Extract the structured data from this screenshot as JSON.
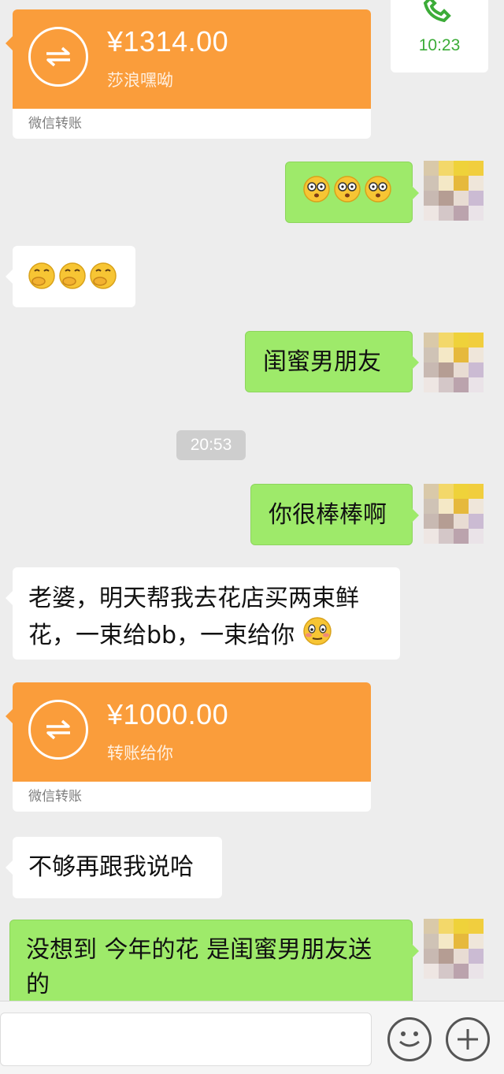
{
  "call": {
    "time": "10:23"
  },
  "transfers": [
    {
      "amount": "¥1314.00",
      "note": "莎浪嘿呦",
      "footer": "微信转账"
    },
    {
      "amount": "¥1000.00",
      "note": "转账给你",
      "footer": "微信转账"
    }
  ],
  "messages": [
    {
      "side": "out",
      "kind": "emoji",
      "emoji": "shocked-face-emoji x3"
    },
    {
      "side": "in",
      "kind": "emoji",
      "emoji": "hand-over-mouth-emoji x3"
    },
    {
      "side": "out",
      "text": "闺蜜男朋友"
    },
    {
      "side": "out",
      "text": "你很棒棒啊"
    },
    {
      "side": "in",
      "text_line1": "老婆，明天帮我去花店买两束鲜",
      "text_line2": "花，一束给bb，一束给你",
      "emoji": "flushed-face-emoji"
    },
    {
      "side": "in",
      "text": "不够再跟我说哈"
    },
    {
      "side": "out",
      "text_line1": "没想到 今年的花 是闺蜜男朋友送",
      "text_line2": "的"
    }
  ],
  "timestamp": "20:53",
  "colors": {
    "background": "#ededed",
    "transfer_orange": "#fa9d3b",
    "outgoing_bubble": "#9eea6a",
    "call_green": "#3cac38"
  },
  "input_bar": {
    "icons": [
      "emoji-icon",
      "plus-icon"
    ]
  }
}
